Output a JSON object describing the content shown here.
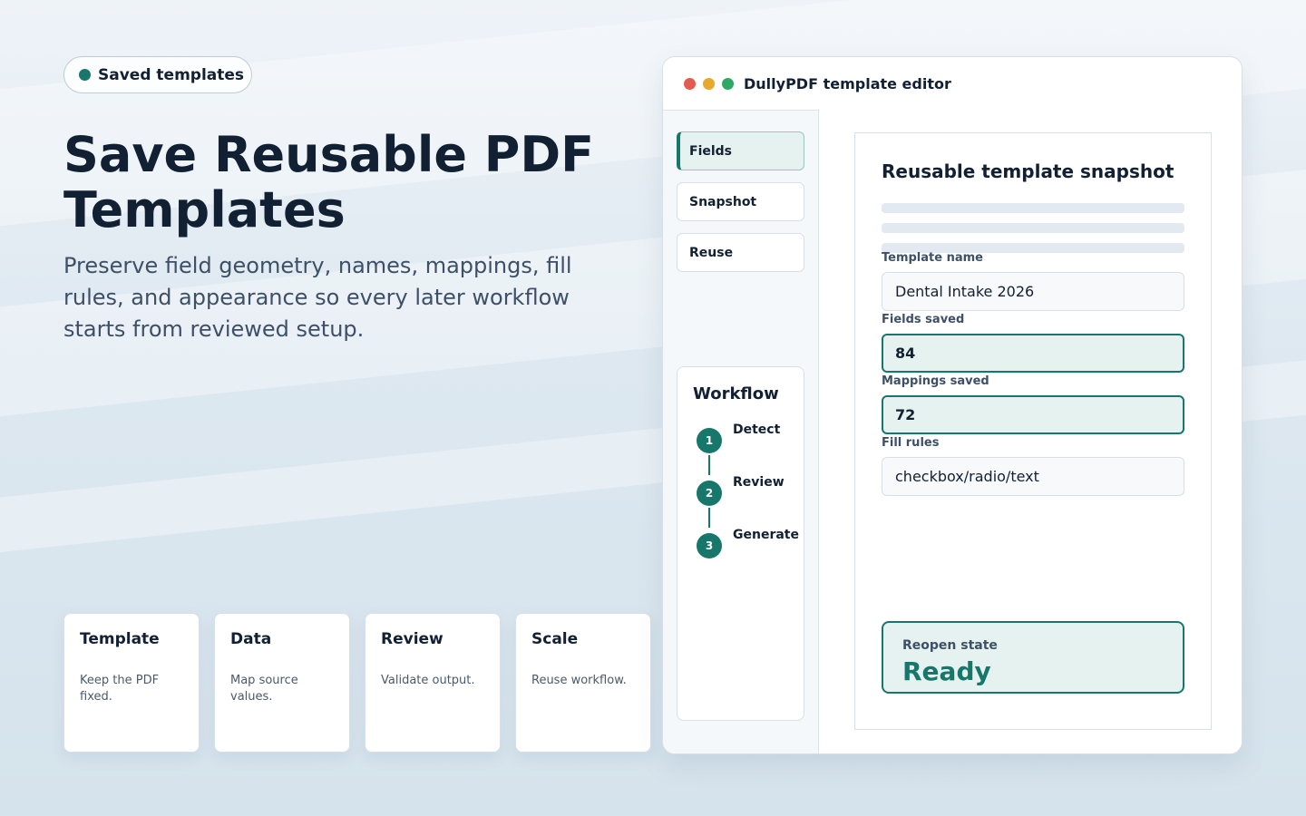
{
  "colors": {
    "accent": "#17776a",
    "close": "#e55a4f",
    "minimize": "#e8a82c",
    "maximize": "#2fa866"
  },
  "badge": {
    "icon": "status-dot-icon",
    "label": "Saved templates"
  },
  "hero": {
    "title": "Save Reusable PDF Templates",
    "subtitle": "Preserve field geometry, names, mappings, fill rules, and appearance so every later workflow starts from reviewed setup."
  },
  "cards": [
    {
      "title": "Template",
      "text": "Keep the PDF fixed."
    },
    {
      "title": "Data",
      "text": "Map source values."
    },
    {
      "title": "Review",
      "text": "Validate output."
    },
    {
      "title": "Scale",
      "text": "Reuse workflow."
    }
  ],
  "window": {
    "title": "DullyPDF template editor",
    "nav": [
      {
        "label": "Fields",
        "active": true
      },
      {
        "label": "Snapshot",
        "active": false
      },
      {
        "label": "Reuse",
        "active": false
      }
    ],
    "workflow": {
      "title": "Workflow",
      "steps": [
        {
          "num": "1",
          "label": "Detect"
        },
        {
          "num": "2",
          "label": "Review"
        },
        {
          "num": "3",
          "label": "Generate"
        }
      ]
    },
    "panel": {
      "title": "Reusable template snapshot",
      "fields": [
        {
          "label": "Template name",
          "value": "Dental Intake 2026",
          "highlight": false
        },
        {
          "label": "Fields saved",
          "value": "84",
          "highlight": true
        },
        {
          "label": "Mappings saved",
          "value": "72",
          "highlight": true
        },
        {
          "label": "Fill rules",
          "value": "checkbox/radio/text",
          "highlight": false
        }
      ],
      "reopen": {
        "label": "Reopen state",
        "value": "Ready"
      }
    }
  }
}
